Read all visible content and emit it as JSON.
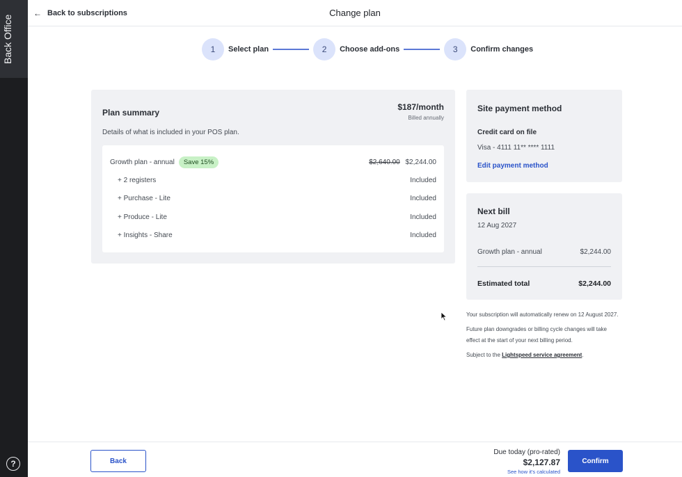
{
  "side_rail": {
    "label": "Back Office",
    "help_symbol": "?"
  },
  "header": {
    "back_label": "Back to subscriptions",
    "title": "Change plan"
  },
  "steps": [
    {
      "number": "1",
      "label": "Select plan"
    },
    {
      "number": "2",
      "label": "Choose add-ons"
    },
    {
      "number": "3",
      "label": "Confirm changes"
    }
  ],
  "plan_summary": {
    "title": "Plan summary",
    "price": "$187/month",
    "billed": "Billed annually",
    "description": "Details of what is included in your POS plan.",
    "plan": {
      "name": "Growth plan - annual",
      "badge": "Save 15%",
      "old_price": "$2,640.00",
      "price": "$2,244.00"
    },
    "items": [
      {
        "name": "+ 2 registers",
        "value": "Included"
      },
      {
        "name": "+ Purchase - Lite",
        "value": "Included"
      },
      {
        "name": "+ Produce - Lite",
        "value": "Included"
      },
      {
        "name": "+ Insights - Share",
        "value": "Included"
      }
    ]
  },
  "payment": {
    "title": "Site payment method",
    "card_label": "Credit card on file",
    "card_number": "Visa - 4111 11** **** 1111",
    "edit_label": "Edit payment method"
  },
  "next_bill": {
    "title": "Next bill",
    "date": "12 Aug 2027",
    "line_label": "Growth plan - annual",
    "line_value": "$2,244.00",
    "total_label": "Estimated total",
    "total_value": "$2,244.00"
  },
  "notes": {
    "renew": "Your subscription will automatically renew on 12 August 2027.",
    "future": "Future plan downgrades or billing cycle changes will take effect at the start of your next billing period.",
    "subject_prefix": "Subject to the ",
    "agreement": "Lightspeed service agreement",
    "subject_suffix": "."
  },
  "footer": {
    "back_label": "Back",
    "due_label": "Due today (pro-rated)",
    "due_amount": "$2,127.87",
    "calc_link": "See how it's calculated",
    "confirm_label": "Confirm"
  },
  "colors": {
    "accent": "#2a53c9",
    "step_circle": "#dbe3fb",
    "badge": "#c8f1c6",
    "rail": "#1c1d20"
  }
}
